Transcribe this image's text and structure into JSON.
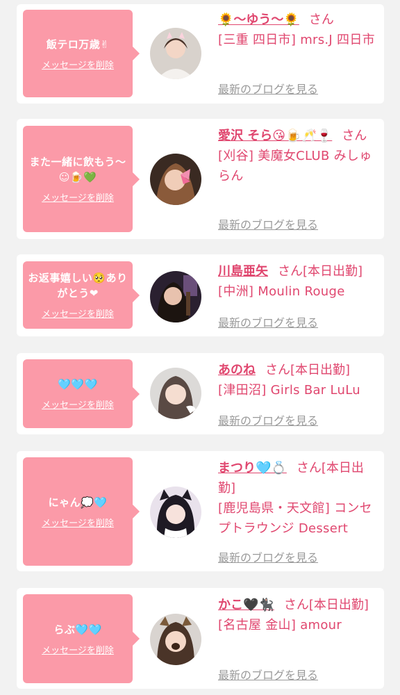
{
  "delete_label": "メッセージを削除",
  "blog_label": "最新のブログを見る",
  "colors": {
    "accent_pink": "#e0476f",
    "bubble_pink": "#fb9aa8",
    "link_gray": "#9a9a9a"
  },
  "items": [
    {
      "message": "飯テロ万歳✌",
      "name": "🌻〜ゆう〜🌻",
      "suffix": "さん",
      "shop": "[三重 四日市] mrs.J 四日市"
    },
    {
      "message": "また一緒に飲もう〜☺🍺💚",
      "name": "愛沢 そら😘🍺🥂🍷",
      "suffix": "さん",
      "shop": "[刈谷] 美魔女CLUB みしゅらん"
    },
    {
      "message": "お返事嬉しい🥺ありがとう❤",
      "name": "川島亜矢",
      "suffix": "さん[本日出勤]",
      "shop": "[中洲] Moulin Rouge"
    },
    {
      "message": "🩵🩵🩵",
      "name": "あのね",
      "suffix": "さん[本日出勤]",
      "shop": "[津田沼] Girls Bar LuLu"
    },
    {
      "message": "にゃん💭🩵",
      "name": "まつり🩵💍",
      "suffix": "さん[本日出勤]",
      "shop": "[鹿児島県・天文館] コンセプトラウンジ Dessert"
    },
    {
      "message": "らぶ🩵🩵",
      "name": "かこ🖤🐈‍⬛",
      "suffix": "さん[本日出勤]",
      "shop": "[名古屋 金山] amour"
    }
  ]
}
